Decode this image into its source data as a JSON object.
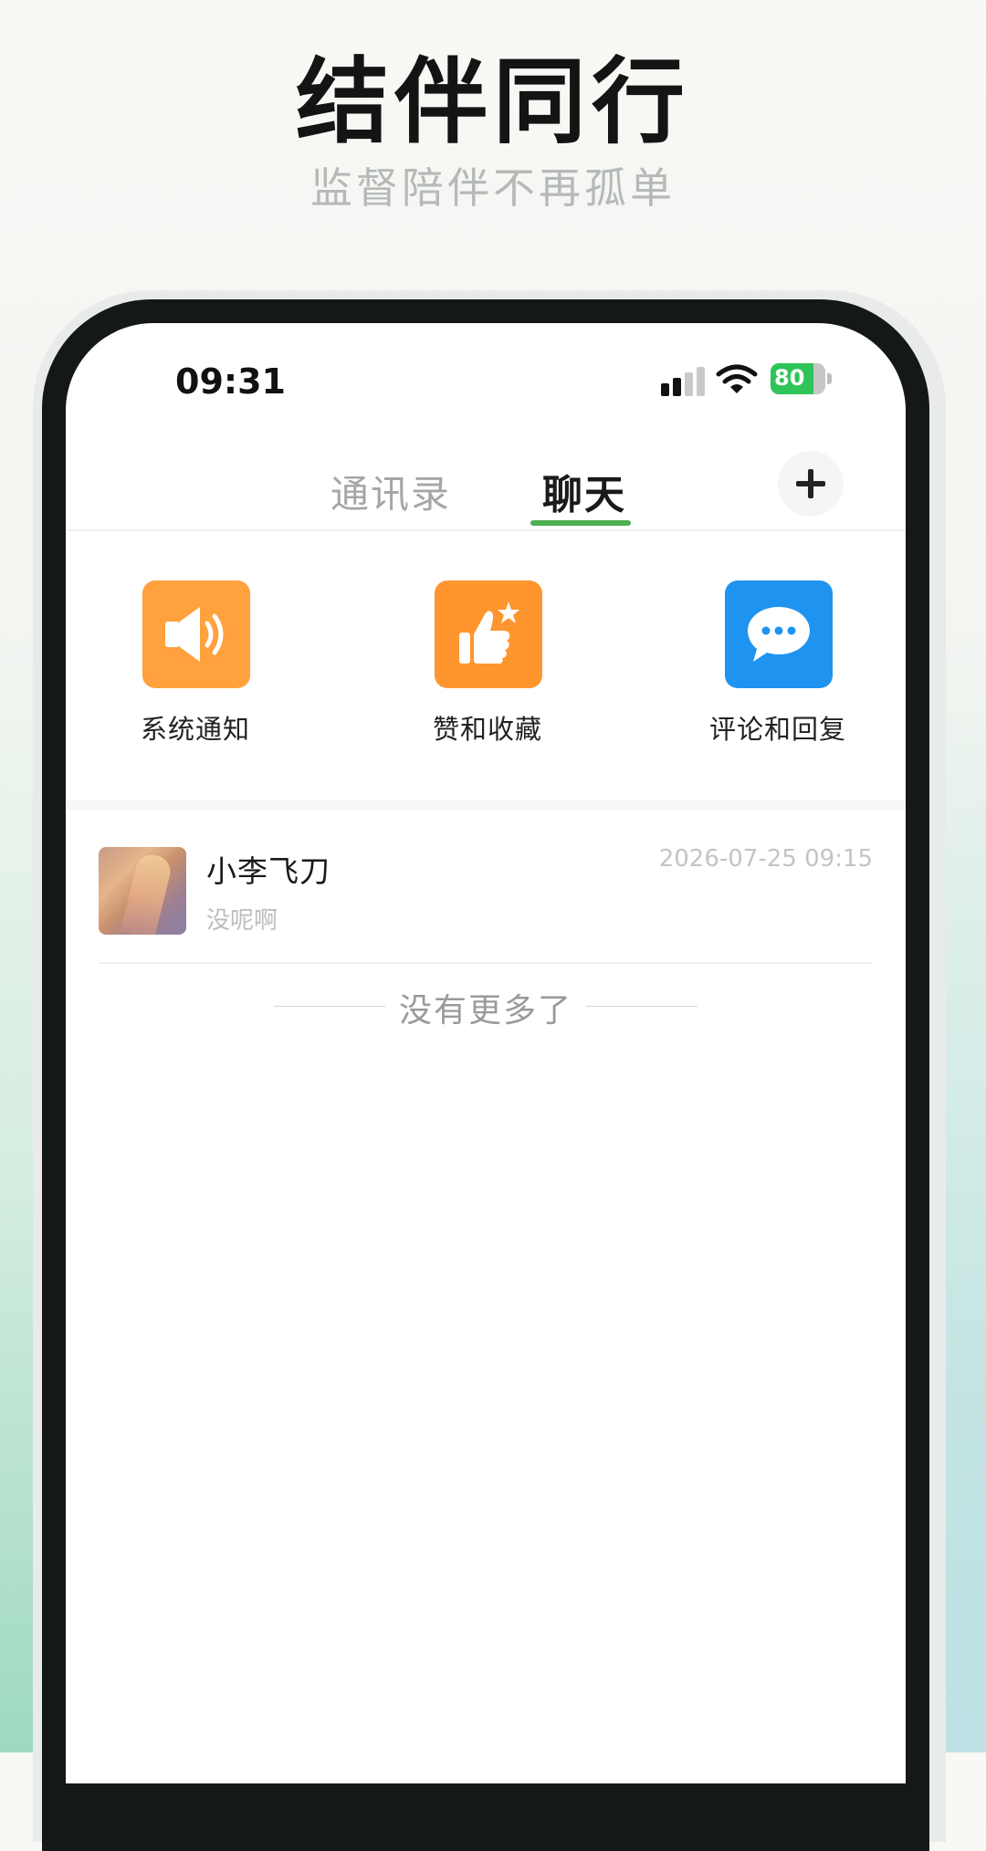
{
  "hero": {
    "title": "结伴同行",
    "subtitle": "监督陪伴不再孤单"
  },
  "status_bar": {
    "time": "09:31",
    "battery": "80",
    "icons": [
      "signal-icon",
      "wifi-icon",
      "battery-charging-icon"
    ]
  },
  "tabs": [
    {
      "label": "通讯录",
      "active": false
    },
    {
      "label": "聊天",
      "active": true
    }
  ],
  "add_button_icon": "plus-icon",
  "shortcuts": [
    {
      "label": "系统通知",
      "icon": "speaker-icon",
      "color": "#FFA13D"
    },
    {
      "label": "赞和收藏",
      "icon": "thumbs-up-star-icon",
      "color": "#FF952E"
    },
    {
      "label": "评论和回复",
      "icon": "chat-bubble-icon",
      "color": "#1E93F0"
    }
  ],
  "conversations": [
    {
      "name": "小李飞刀",
      "preview": "没呢啊",
      "time": "2026-07-25 09:15"
    }
  ],
  "list_end_text": "没有更多了",
  "colors": {
    "accent_green": "#4CAF50",
    "phone_frame": "#141816"
  }
}
